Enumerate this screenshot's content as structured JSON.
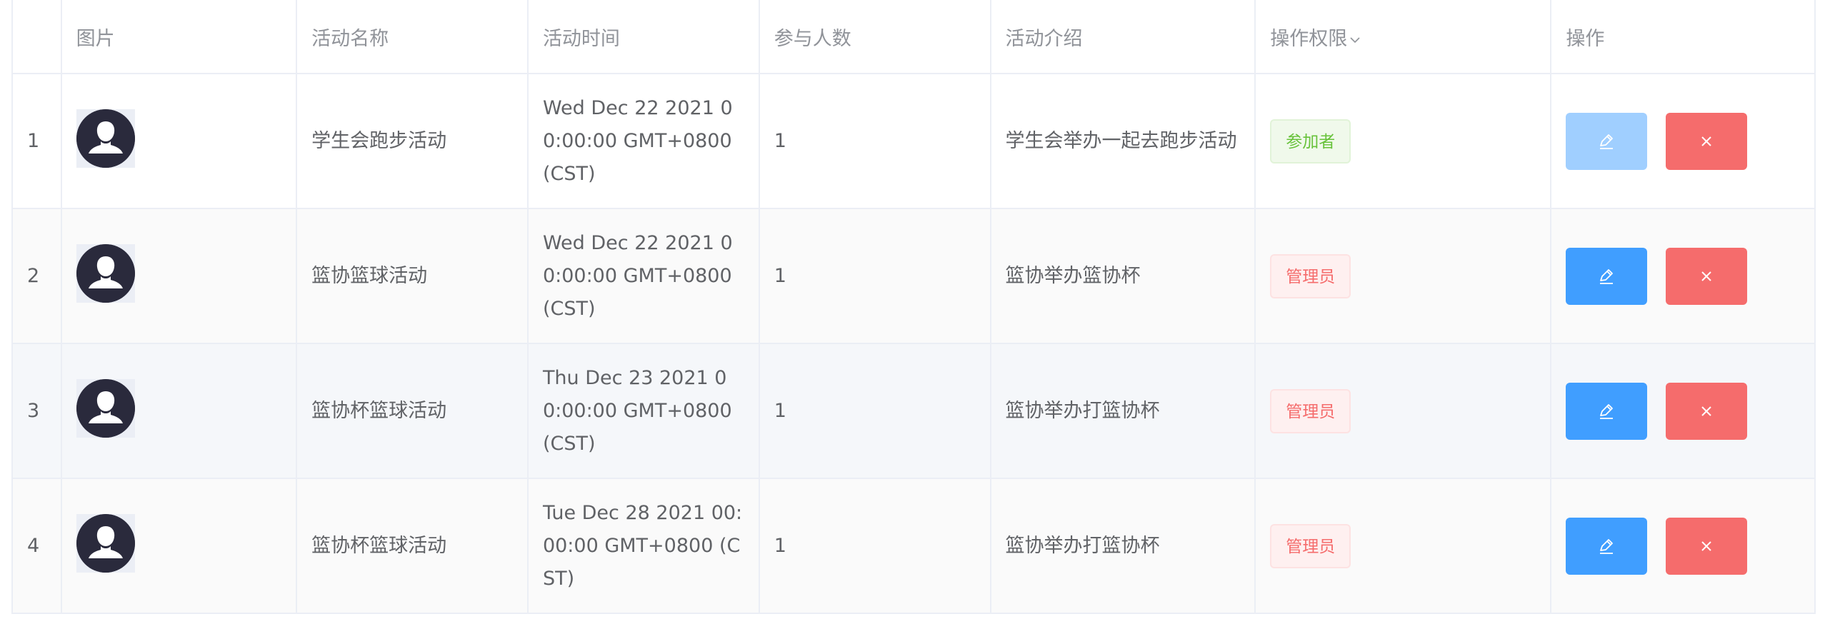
{
  "table": {
    "headers": {
      "index": "",
      "image": "图片",
      "name": "活动名称",
      "time": "活动时间",
      "participants": "参与人数",
      "intro": "活动介绍",
      "permission": "操作权限",
      "actions": "操作"
    },
    "sort_caret_icon": "chevron-down-icon",
    "rows": [
      {
        "index": "1",
        "name": "学生会跑步活动",
        "time": "Wed Dec 22 2021 00:00:00 GMT+0800 (CST)",
        "participants": "1",
        "intro": "学生会举办一起去跑步活动",
        "permission": "参加者",
        "permission_type": "success",
        "edit_disabled": true
      },
      {
        "index": "2",
        "name": "篮协篮球活动",
        "time": "Wed Dec 22 2021 00:00:00 GMT+0800 (CST)",
        "participants": "1",
        "intro": "篮协举办篮协杯",
        "permission": "管理员",
        "permission_type": "danger",
        "edit_disabled": false
      },
      {
        "index": "3",
        "name": "篮协杯篮球活动",
        "time": "Thu Dec 23 2021 00:00:00 GMT+0800 (CST)",
        "participants": "1",
        "intro": "篮协举办打篮协杯",
        "permission": "管理员",
        "permission_type": "danger",
        "edit_disabled": false
      },
      {
        "index": "4",
        "name": "篮协杯篮球活动",
        "time": "Tue Dec 28 2021 00:00:00 GMT+0800 (CST)",
        "participants": "1",
        "intro": "篮协举办打篮协杯",
        "permission": "管理员",
        "permission_type": "danger",
        "edit_disabled": false
      }
    ]
  },
  "colors": {
    "primary": "#409eff",
    "primary_disabled": "#a0cfff",
    "danger": "#f56c6c",
    "success": "#67c23a",
    "avatar_bg": "#2a2a3c"
  },
  "icons": {
    "edit": "edit-icon",
    "delete": "close-icon",
    "avatar": "user-avatar-icon"
  }
}
